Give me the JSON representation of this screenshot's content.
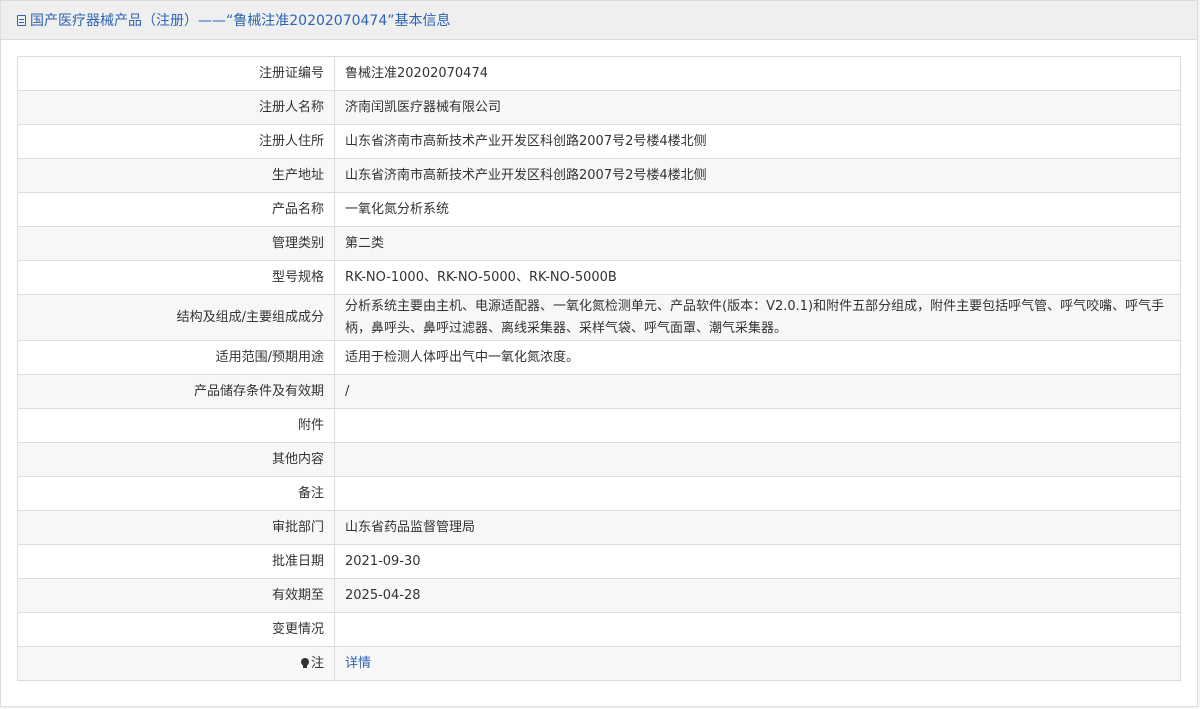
{
  "header": {
    "title": "国产医疗器械产品（注册）——“鲁械注准20202070474”基本信息"
  },
  "rows": [
    {
      "label": "注册证编号",
      "value": "鲁械注准20202070474"
    },
    {
      "label": "注册人名称",
      "value": "济南闰凯医疗器械有限公司"
    },
    {
      "label": "注册人住所",
      "value": "山东省济南市高新技术产业开发区科创路2007号2号楼4楼北侧"
    },
    {
      "label": "生产地址",
      "value": "山东省济南市高新技术产业开发区科创路2007号2号楼4楼北侧"
    },
    {
      "label": "产品名称",
      "value": "一氧化氮分析系统"
    },
    {
      "label": "管理类别",
      "value": "第二类"
    },
    {
      "label": "型号规格",
      "value": "RK-NO-1000、RK-NO-5000、RK-NO-5000B"
    },
    {
      "label": "结构及组成/主要组成成分",
      "value": "分析系统主要由主机、电源适配器、一氧化氮检测单元、产品软件(版本：V2.0.1)和附件五部分组成，附件主要包括呼气管、呼气咬嘴、呼气手柄，鼻呼头、鼻呼过滤器、离线采集器、采样气袋、呼气面罩、潮气采集器。"
    },
    {
      "label": "适用范围/预期用途",
      "value": "适用于检测人体呼出气中一氧化氮浓度。"
    },
    {
      "label": "产品储存条件及有效期",
      "value": "/"
    },
    {
      "label": "附件",
      "value": ""
    },
    {
      "label": "其他内容",
      "value": ""
    },
    {
      "label": "备注",
      "value": ""
    },
    {
      "label": "审批部门",
      "value": "山东省药品监督管理局"
    },
    {
      "label": "批准日期",
      "value": "2021-09-30"
    },
    {
      "label": "有效期至",
      "value": "2025-04-28"
    },
    {
      "label": "变更情况",
      "value": ""
    },
    {
      "label": "注",
      "value": "详情",
      "icon": "lightbulb-icon"
    }
  ]
}
